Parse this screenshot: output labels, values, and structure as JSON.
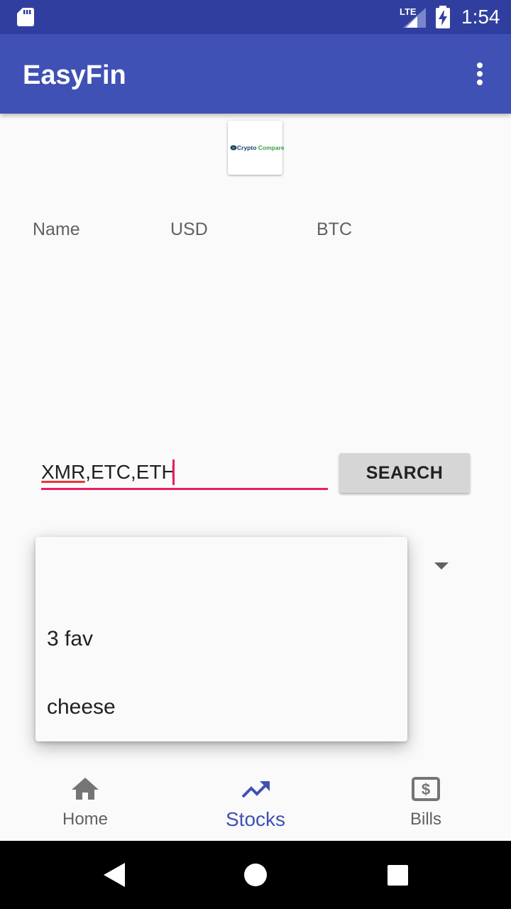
{
  "status_bar": {
    "network_label": "LTE",
    "time": "1:54"
  },
  "app_bar": {
    "title": "EasyFin"
  },
  "logo": {
    "text_part1": "Crypto",
    "text_part2": "Compare"
  },
  "table": {
    "columns": [
      "Name",
      "USD",
      "BTC"
    ]
  },
  "search": {
    "value": "XMR,ETC,ETH",
    "button_label": "SEARCH"
  },
  "dropdown": {
    "items": [
      "",
      "3 fav",
      "cheese"
    ]
  },
  "bottom_nav": {
    "items": [
      {
        "label": "Home",
        "icon": "home-icon"
      },
      {
        "label": "Stocks",
        "icon": "trending-up-icon"
      },
      {
        "label": "Bills",
        "icon": "dollar-bill-icon"
      }
    ],
    "active": "Stocks"
  },
  "colors": {
    "primary": "#3f51b5",
    "primary_dark": "#303f9f",
    "accent": "#e91e63"
  }
}
